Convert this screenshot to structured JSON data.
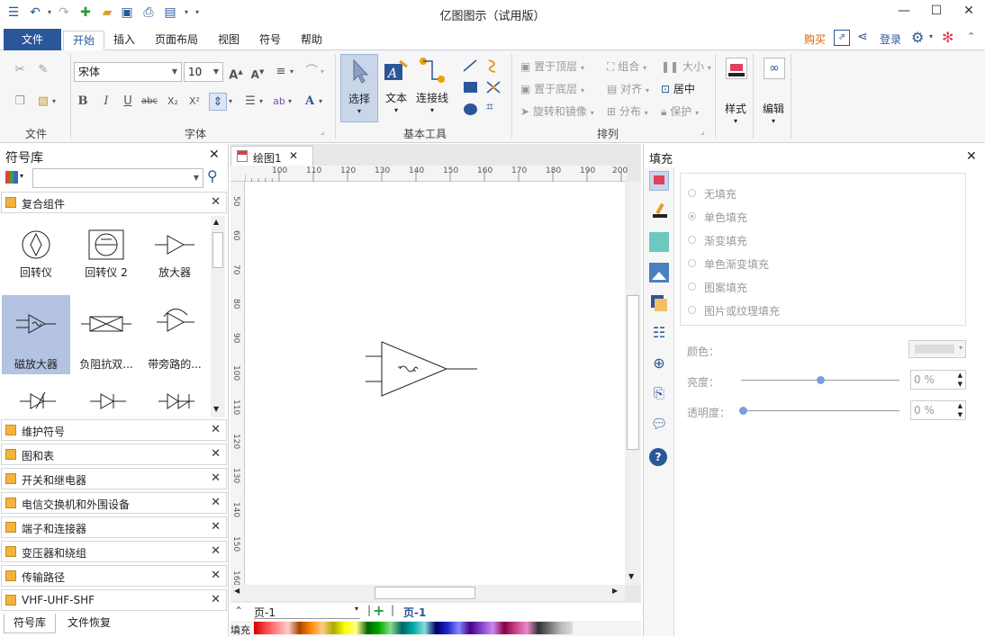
{
  "window": {
    "title": "亿图图示（试用版）"
  },
  "menu_tabs": [
    "文件",
    "开始",
    "插入",
    "页面布局",
    "视图",
    "符号",
    "帮助"
  ],
  "right_links": {
    "buy": "购买",
    "login": "登录"
  },
  "ribbon": {
    "groups": {
      "file": "文件",
      "font": "字体",
      "basic": "基本工具",
      "arrange": "排列"
    },
    "font_name": "宋体",
    "font_size": "10",
    "tools": {
      "select": "选择",
      "text": "文本",
      "connector": "连接线"
    },
    "arrange": {
      "bring_top": "置于顶层",
      "send_bottom": "置于底层",
      "rotate": "旋转和镜像",
      "group": "组合",
      "align": "对齐",
      "distribute": "分布",
      "size": "大小",
      "center": "居中",
      "protect": "保护"
    },
    "style": "样式",
    "edit": "编辑"
  },
  "library": {
    "title": "符号库",
    "open_category": "复合组件",
    "shapes": [
      "回转仪",
      "回转仪 2",
      "放大器",
      "磁放大器",
      "负阻抗双...",
      "带旁路的..."
    ],
    "categories": [
      "维护符号",
      "图和表",
      "开关和继电器",
      "电信交换机和外围设备",
      "端子和连接器",
      "变压器和绕组",
      "传输路径",
      "VHF-UHF-SHF"
    ],
    "bottom_tabs": [
      "符号库",
      "文件恢复"
    ]
  },
  "document_tab": "绘图1",
  "ruler_h": [
    "100",
    "110",
    "120",
    "130",
    "140",
    "150",
    "160",
    "170",
    "180",
    "190",
    "200"
  ],
  "ruler_v": [
    "50",
    "60",
    "70",
    "80",
    "90",
    "100",
    "110",
    "120",
    "130",
    "140",
    "150",
    "160"
  ],
  "page_bar": {
    "select": "页-1",
    "active_page": "页-1"
  },
  "fill_panel": {
    "title": "填充",
    "options": [
      "无填充",
      "单色填充",
      "渐变填充",
      "单色渐变填充",
      "图案填充",
      "图片或纹理填充"
    ],
    "color_label": "颜色：",
    "brightness_label": "亮度：",
    "brightness_value": "0 %",
    "transparency_label": "透明度：",
    "transparency_value": "0 %"
  },
  "status": {
    "fill_label": "填充"
  },
  "colors": {
    "brand": "#2b579a",
    "selected_shape_bg": "#b4c3e3",
    "buy": "#e05a00"
  }
}
